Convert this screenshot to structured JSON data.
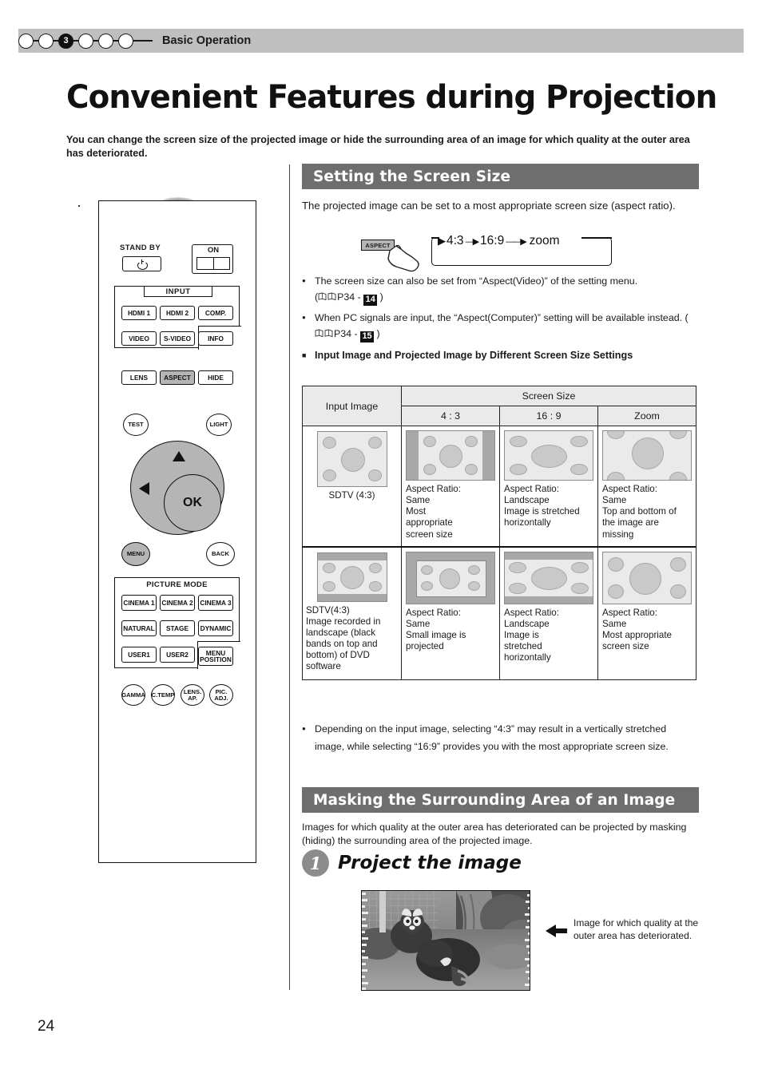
{
  "header": {
    "chapter_number": "3",
    "chapter_title": "Basic Operation",
    "total_dots": 6,
    "active_index": 2
  },
  "page_title": "Convenient Features during Projection",
  "intro": "You can change the screen size of the projected image or hide the surrounding area of an image for which quality at the outer area has deteriorated.",
  "remote": {
    "standby_label": "STAND BY",
    "on_label": "ON",
    "input_label": "INPUT",
    "input_buttons": [
      "HDMI 1",
      "HDMI 2",
      "COMP.",
      "VIDEO",
      "S-VIDEO",
      "INFO"
    ],
    "lens_row": [
      "LENS",
      "ASPECT",
      "HIDE"
    ],
    "highlighted_lens_row": "ASPECT",
    "test_label": "TEST",
    "light_label": "LIGHT",
    "ok_label": "OK",
    "menu_label": "MENU",
    "back_label": "BACK",
    "picture_mode_label": "PICTURE MODE",
    "picture_mode_buttons": [
      "CINEMA 1",
      "CINEMA 2",
      "CINEMA 3",
      "NATURAL",
      "STAGE",
      "DYNAMIC",
      "USER1",
      "USER2",
      "MENU POSITION"
    ],
    "bottom_circles": [
      "GAMMA",
      "C.TEMP",
      "LENS. AP.",
      "PIC. ADJ."
    ]
  },
  "section1": {
    "heading": "Setting the Screen Size",
    "body": "The projected image can be set to a most appropriate screen size (aspect ratio).",
    "aspect_chip": "ASPECT",
    "flow": [
      "4:3",
      "16:9",
      "zoom"
    ],
    "bullets": [
      {
        "text_before": "The screen size can also be set from “Aspect(Video)” of the setting menu.",
        "ref_prefix": "(",
        "ref_page": "P34 - ",
        "ref_badge": "14",
        "ref_suffix": " )"
      },
      {
        "text_before": "When PC signals are input, the “Aspect(Computer)” setting will be available instead. (",
        "ref_page": "P34 - ",
        "ref_badge": "15",
        "ref_suffix": " )"
      }
    ],
    "subheading": "Input Image and Projected Image by Different Screen Size Settings",
    "table": {
      "col_input": "Input Image",
      "col_group": "Screen Size",
      "cols": [
        "4 : 3",
        "16 : 9",
        "Zoom"
      ],
      "rows": [
        {
          "input_caption": "SDTV (4:3)",
          "cells": [
            "Aspect Ratio:\nSame\nMost\nappropriate\nscreen size",
            "Aspect Ratio:\nLandscape\nImage is stretched\nhorizontally",
            "Aspect Ratio:\nSame\nTop and bottom of\nthe image are\nmissing"
          ]
        },
        {
          "input_caption": "SDTV(4:3)\nImage recorded in\nlandscape (black\nbands on top and\nbottom) of DVD\nsoftware",
          "cells": [
            "Aspect Ratio:\nSame\nSmall image is\nprojected",
            "Aspect Ratio:\nLandscape\nImage is\nstretched\nhorizontally",
            "Aspect Ratio:\nSame\nMost appropriate\nscreen size"
          ]
        }
      ]
    },
    "footnote": "Depending on the input image, selecting “4:3” may result in a vertically stretched image, while selecting “16:9” provides you with the most appropriate screen size."
  },
  "section2": {
    "heading": "Masking the Surrounding Area of an Image",
    "body": "Images for which quality at the outer area has deteriorated can be projected by masking (hiding) the surrounding area of the projected image.",
    "step_number": "1",
    "step_title": "Project the image",
    "photo_caption": "Image for which quality at the outer area has deteriorated."
  },
  "page_number": "24",
  "colors": {
    "chapter_bar": "#bfbfbf",
    "section_heading": "#6e6e6e",
    "highlight_button": "#b5b5b5",
    "table_header": "#eaeaea",
    "screen_fill": "#eaeaea",
    "bar_fill": "#a8a8a8",
    "bubble_fill": "#c9c9c9",
    "badge": "#111111",
    "step_circle": "#8c8c8c"
  }
}
